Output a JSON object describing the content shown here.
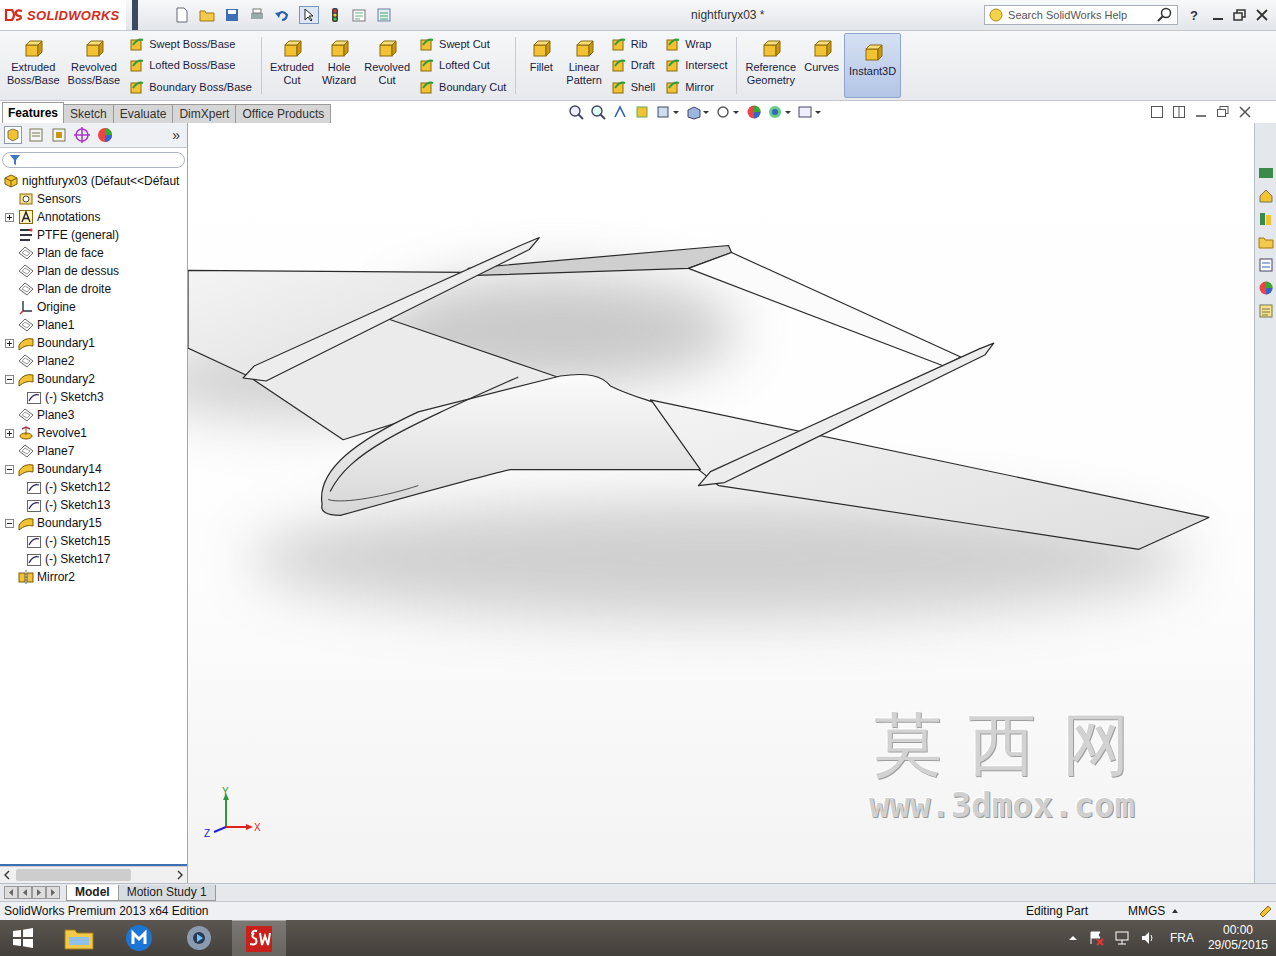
{
  "app": {
    "logo": "SOLIDWORKS",
    "title": "nightfuryx03 *",
    "search_placeholder": "Search SolidWorks Help",
    "help": "?"
  },
  "ribbon": [
    {
      "kind": "large",
      "lines": [
        "Extruded",
        "Boss/Base"
      ],
      "active": false
    },
    {
      "kind": "large",
      "lines": [
        "Revolved",
        "Boss/Base"
      ],
      "active": false
    },
    {
      "kind": "stack",
      "lines": [
        "Swept Boss/Base",
        "Lofted Boss/Base",
        "Boundary Boss/Base"
      ],
      "active": false
    },
    {
      "kind": "separator",
      "lines": [],
      "active": false
    },
    {
      "kind": "large",
      "lines": [
        "Extruded",
        "Cut"
      ],
      "active": false
    },
    {
      "kind": "large",
      "lines": [
        "Hole",
        "Wizard"
      ],
      "active": false
    },
    {
      "kind": "large",
      "lines": [
        "Revolved",
        "Cut"
      ],
      "active": false
    },
    {
      "kind": "stack",
      "lines": [
        "Swept Cut",
        "Lofted Cut",
        "Boundary Cut"
      ],
      "active": false
    },
    {
      "kind": "separator",
      "lines": [],
      "active": false
    },
    {
      "kind": "large",
      "lines": [
        "Fillet"
      ],
      "active": false
    },
    {
      "kind": "large",
      "lines": [
        "Linear",
        "Pattern"
      ],
      "active": false
    },
    {
      "kind": "stack",
      "lines": [
        "Rib",
        "Draft",
        "Shell"
      ],
      "active": false
    },
    {
      "kind": "stack",
      "lines": [
        "Wrap",
        "Intersect",
        "Mirror"
      ],
      "active": false
    },
    {
      "kind": "separator",
      "lines": [],
      "active": false
    },
    {
      "kind": "large",
      "lines": [
        "Reference",
        "Geometry"
      ],
      "active": false
    },
    {
      "kind": "large",
      "lines": [
        "Curves"
      ],
      "active": false
    },
    {
      "kind": "large",
      "lines": [
        "Instant3D"
      ],
      "active": true
    }
  ],
  "tabs": [
    {
      "label": "Features",
      "selected": true
    },
    {
      "label": "Sketch",
      "selected": false
    },
    {
      "label": "Evaluate",
      "selected": false
    },
    {
      "label": "DimXpert",
      "selected": false
    },
    {
      "label": "Office Products",
      "selected": false
    }
  ],
  "panel_more": "»",
  "tree": [
    {
      "label": "nightfuryx03  (Défaut<<Défaut",
      "depth": 0,
      "kind": "part",
      "expandable": false,
      "expanded": false
    },
    {
      "label": "Sensors",
      "depth": 1,
      "kind": "sensor",
      "expandable": false,
      "expanded": false
    },
    {
      "label": "Annotations",
      "depth": 1,
      "kind": "annotation",
      "expandable": true,
      "expanded": false
    },
    {
      "label": "PTFE (general)",
      "depth": 1,
      "kind": "material",
      "expandable": false,
      "expanded": false
    },
    {
      "label": "Plan de face",
      "depth": 1,
      "kind": "plane",
      "expandable": false,
      "expanded": false
    },
    {
      "label": "Plan de dessus",
      "depth": 1,
      "kind": "plane",
      "expandable": false,
      "expanded": false
    },
    {
      "label": "Plan de droite",
      "depth": 1,
      "kind": "plane",
      "expandable": false,
      "expanded": false
    },
    {
      "label": "Origine",
      "depth": 1,
      "kind": "origin",
      "expandable": false,
      "expanded": false
    },
    {
      "label": "Plane1",
      "depth": 1,
      "kind": "plane",
      "expandable": false,
      "expanded": false
    },
    {
      "label": "Boundary1",
      "depth": 1,
      "kind": "feature",
      "expandable": true,
      "expanded": false
    },
    {
      "label": "Plane2",
      "depth": 1,
      "kind": "plane",
      "expandable": false,
      "expanded": false
    },
    {
      "label": "Boundary2",
      "depth": 1,
      "kind": "feature",
      "expandable": true,
      "expanded": true
    },
    {
      "label": "(-) Sketch3",
      "depth": 2,
      "kind": "sketch",
      "expandable": false,
      "expanded": false
    },
    {
      "label": "Plane3",
      "depth": 1,
      "kind": "plane",
      "expandable": false,
      "expanded": false
    },
    {
      "label": "Revolve1",
      "depth": 1,
      "kind": "revolve",
      "expandable": true,
      "expanded": false
    },
    {
      "label": "Plane7",
      "depth": 1,
      "kind": "plane",
      "expandable": false,
      "expanded": false
    },
    {
      "label": "Boundary14",
      "depth": 1,
      "kind": "feature",
      "expandable": true,
      "expanded": true
    },
    {
      "label": "(-) Sketch12",
      "depth": 2,
      "kind": "sketch",
      "expandable": false,
      "expanded": false
    },
    {
      "label": "(-) Sketch13",
      "depth": 2,
      "kind": "sketch",
      "expandable": false,
      "expanded": false
    },
    {
      "label": "Boundary15",
      "depth": 1,
      "kind": "feature",
      "expandable": true,
      "expanded": true
    },
    {
      "label": "(-) Sketch15",
      "depth": 2,
      "kind": "sketch",
      "expandable": false,
      "expanded": false
    },
    {
      "label": "(-) Sketch17",
      "depth": 2,
      "kind": "sketch",
      "expandable": false,
      "expanded": false
    },
    {
      "label": "Mirror2",
      "depth": 1,
      "kind": "mirror",
      "expandable": false,
      "expanded": false
    }
  ],
  "viewport": {
    "watermark": {
      "title": "莫西网",
      "url": "www.3dmox.com"
    },
    "axes": {
      "y": "Y",
      "z": "Z",
      "x": "X"
    }
  },
  "model_tabs": [
    {
      "label": "Model",
      "selected": true
    },
    {
      "label": "Motion Study 1",
      "selected": false
    }
  ],
  "status_bar": {
    "edition": "SolidWorks Premium 2013 x64 Edition",
    "mode": "Editing Part",
    "units": "MMGS"
  },
  "taskbar": {
    "language": "FRA",
    "time": "00:00",
    "date": "29/05/2015"
  }
}
